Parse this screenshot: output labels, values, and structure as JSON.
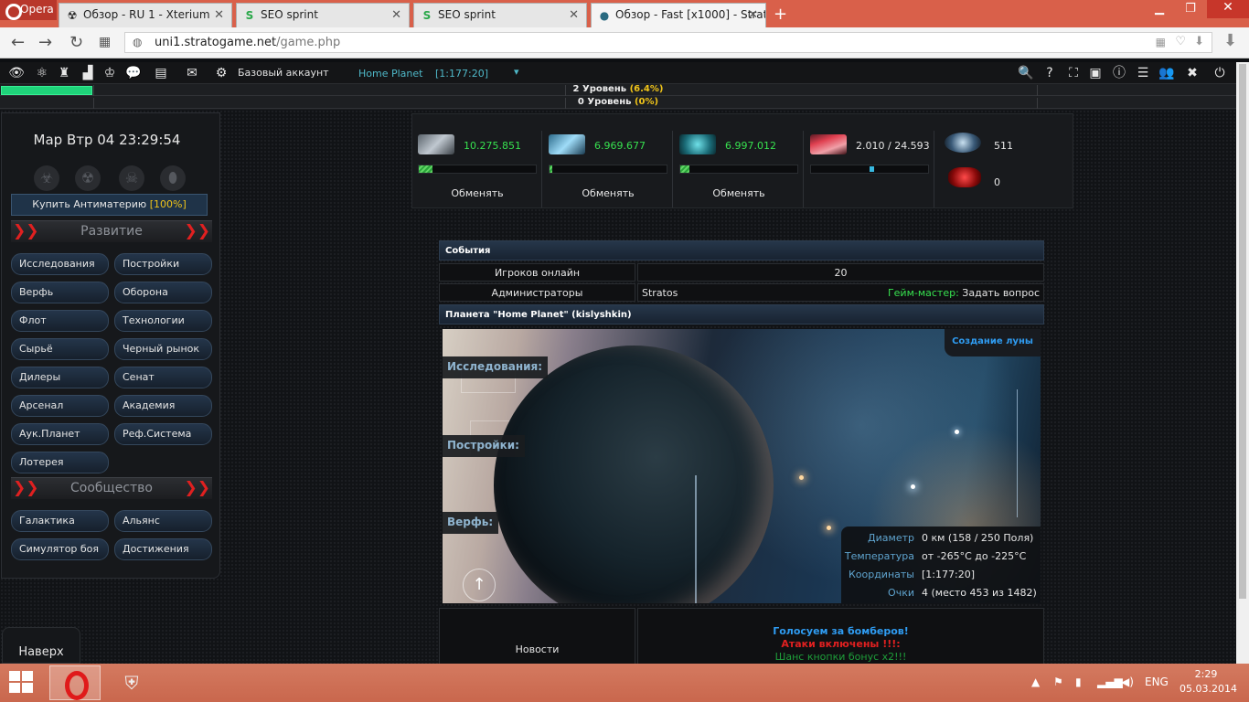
{
  "browser": {
    "opera_label": "Opera",
    "tabs": [
      {
        "title": "Обзор - RU 1 - Xterium"
      },
      {
        "title": "SEO sprint"
      },
      {
        "title": "SEO sprint"
      },
      {
        "title": "Обзор - Fast [x1000] - Strat"
      }
    ],
    "url_domain": "uni1.stratogame.net",
    "url_path": "/game.php"
  },
  "gamebar": {
    "account_label": "Базовый аккаунт",
    "planet_name": "Home Planet",
    "planet_coords": "[1:177:20]"
  },
  "levels": {
    "level1_text": "2 Уровень",
    "level1_pct": "(6.4%)",
    "level1_fill": 0.064,
    "level2_text": "0 Уровень",
    "level2_pct": "(0%)"
  },
  "sidebar": {
    "clock": "Мар Втр 04 23:29:54",
    "buy_antimatter": "Купить Антиматерию",
    "buy_antimatter_pct": "[100%]",
    "section_develop": "Развитие",
    "section_community": "Сообщество",
    "develop_items": [
      "Исследования",
      "Постройки",
      "Верфь",
      "Оборона",
      "Флот",
      "Технологии",
      "Сырьё",
      "Черный рынок",
      "Дилеры",
      "Сенат",
      "Арсенал",
      "Академия",
      "Аук.Планет",
      "Реф.Система",
      "Лотерея"
    ],
    "community_items": [
      "Галактика",
      "Альянс",
      "Симулятор боя",
      "Достижения"
    ]
  },
  "resources": {
    "exchange_label": "Обменять",
    "metal": {
      "value": "10.275.851",
      "fill": 0.12,
      "color": "#c0c8d0"
    },
    "crystal": {
      "value": "6.969.677",
      "fill": 0.02,
      "color": "#7ecbf0"
    },
    "deuterium": {
      "value": "6.997.012",
      "fill": 0.08,
      "color": "#3fb3c0"
    },
    "energy": {
      "value": "2.010 / 24.593",
      "fill": 0.5
    },
    "darkmatter": {
      "value": "511"
    },
    "antimatter": {
      "value": "0"
    }
  },
  "events": {
    "header": "События",
    "online_label": "Игроков онлайн",
    "online_value": "20",
    "admins_label": "Администраторы",
    "admins_value": "Stratos",
    "gm_label": "Гейм-мастер:",
    "gm_link": "Задать вопрос"
  },
  "planet": {
    "header": "Планета \"Home Planet\" (kislyshkin)",
    "moon_button": "Создание луны",
    "overlay_research": "Исследования:",
    "overlay_buildings": "Постройки:",
    "overlay_shipyard": "Верфь:",
    "info": [
      {
        "k": "Диаметр",
        "v": "0 км (158 / 250 Поля)"
      },
      {
        "k": "Температура",
        "v": "от -265°С до -225°С"
      },
      {
        "k": "Координаты",
        "v": "[1:177:20]"
      },
      {
        "k": "Очки",
        "v": "4 (место 453 из 1482)"
      }
    ]
  },
  "news": {
    "label": "Новости",
    "line1": "Голосуем за бомберов!",
    "line2": "Атаки включены !!!:",
    "line3": "Шанс кнопки бонус х2!!!",
    "line1_color": "#2f9cf2",
    "line2_color": "#e02020",
    "line3_color": "#1e9e3a"
  },
  "to_top": "Наверх",
  "taskbar": {
    "lang": "ENG",
    "time": "2:29",
    "date": "05.03.2014"
  }
}
